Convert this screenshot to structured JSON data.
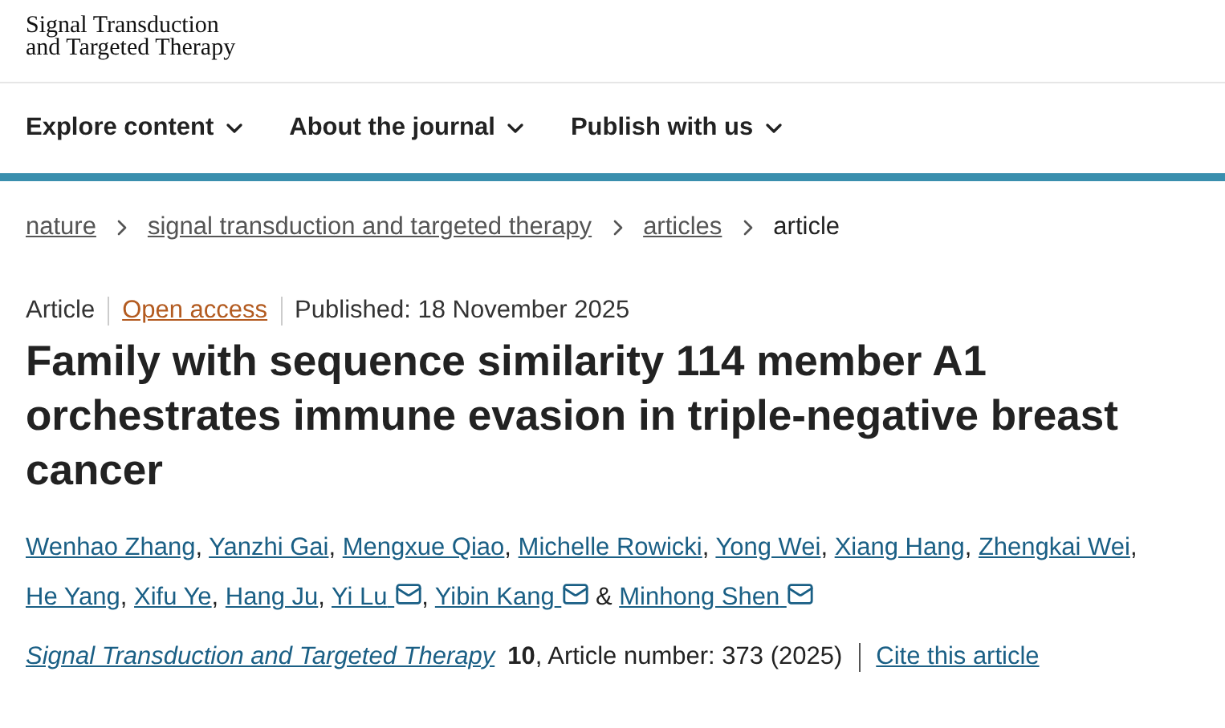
{
  "logo": {
    "lines": [
      "Signal Transduction",
      "and Targeted Therapy"
    ]
  },
  "nav": [
    {
      "label": "Explore content"
    },
    {
      "label": "About the journal"
    },
    {
      "label": "Publish with us"
    }
  ],
  "breadcrumbs": [
    {
      "label": "nature",
      "link": true
    },
    {
      "label": "signal transduction and targeted therapy",
      "link": true
    },
    {
      "label": "articles",
      "link": true
    },
    {
      "label": "article",
      "link": false
    }
  ],
  "meta": {
    "type": "Article",
    "access": "Open access",
    "published": "Published: 18 November 2025"
  },
  "title": "Family with sequence similarity 114 member A1 orchestrates immune evasion in triple-negative breast cancer",
  "authors": [
    {
      "name": "Wenhao Zhang",
      "email": false,
      "sep": ","
    },
    {
      "name": "Yanzhi Gai",
      "email": false,
      "sep": ","
    },
    {
      "name": "Mengxue Qiao",
      "email": false,
      "sep": ","
    },
    {
      "name": "Michelle Rowicki",
      "email": false,
      "sep": ","
    },
    {
      "name": "Yong Wei",
      "email": false,
      "sep": ","
    },
    {
      "name": "Xiang Hang",
      "email": false,
      "sep": ","
    },
    {
      "name": "Zhengkai Wei",
      "email": false,
      "sep": ","
    },
    {
      "name": "He Yang",
      "email": false,
      "sep": ","
    },
    {
      "name": "Xifu Ye",
      "email": false,
      "sep": ","
    },
    {
      "name": "Hang Ju",
      "email": false,
      "sep": ","
    },
    {
      "name": "Yi Lu",
      "email": true,
      "sep": ","
    },
    {
      "name": "Yibin Kang",
      "email": true,
      "sep": "&"
    },
    {
      "name": "Minhong Shen",
      "email": true
    }
  ],
  "citation": {
    "journal": "Signal Transduction and Targeted Therapy",
    "details": "**10**, Article number: 373 (2025)",
    "cite": "Cite this article"
  }
}
